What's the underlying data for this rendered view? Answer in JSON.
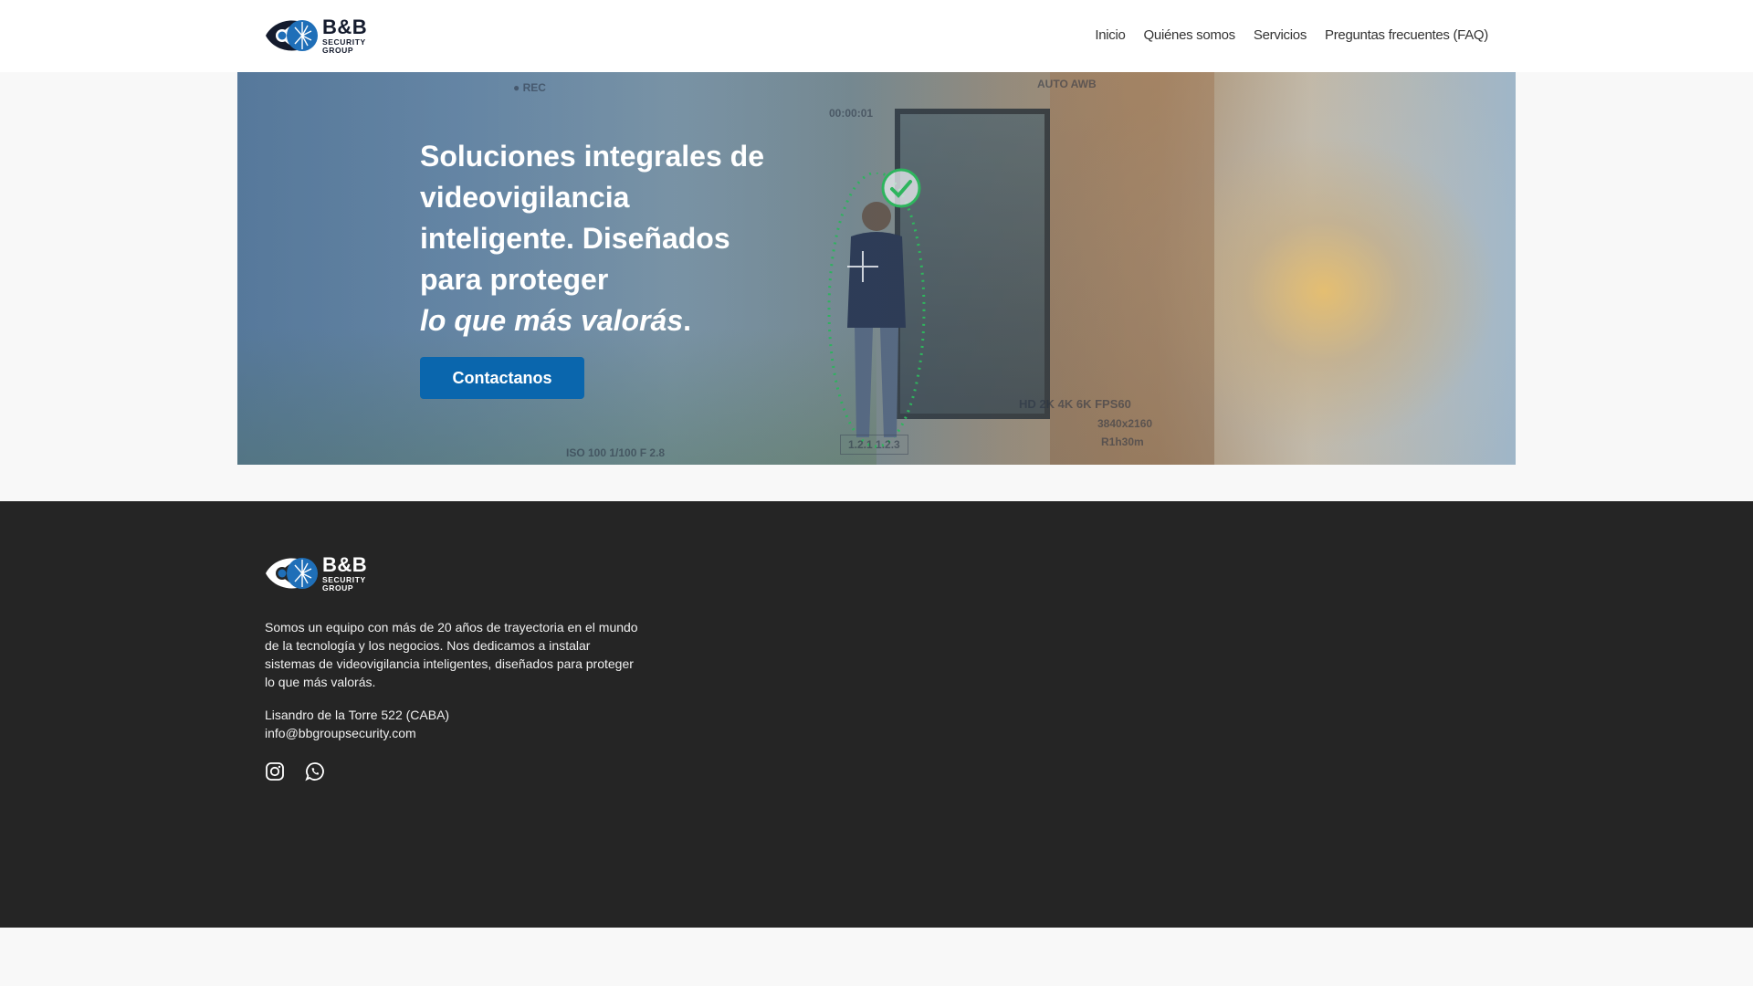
{
  "brand": {
    "name": "B&B",
    "line1": "SECURITY",
    "line2": "GROUP"
  },
  "nav": {
    "items": [
      "Inicio",
      "Quiénes somos",
      "Servicios",
      "Preguntas frecuentes (FAQ)"
    ]
  },
  "hero": {
    "title_lines": [
      "Soluciones integrales de",
      "videovigilancia",
      "inteligente. Diseñados",
      "para proteger"
    ],
    "title_emphasis": "lo que más valorás",
    "title_end": ".",
    "cta_label": "Contactanos",
    "hud": {
      "rec": "● REC",
      "time": "00:00:01",
      "auto": "AUTO\nAWB",
      "hd": "HD 2K 4K 6K   FPS60",
      "res": "3840x2160",
      "rh": "R1h30m",
      "iso": "ISO 100  1/100  F 2.8",
      "seg": "1.2.1   1.2.3"
    }
  },
  "footer": {
    "about": "Somos un equipo con más de 20 años de trayectoria en el mundo de la tecnología y los negocios. Nos dedicamos a instalar sistemas de videovigilancia inteligentes, diseñados para proteger lo que más valorás.",
    "address": "Lisandro de la Torre 522 (CABA)",
    "email": "info@bbgroupsecurity.com",
    "social": [
      "instagram-icon",
      "whatsapp-icon"
    ]
  },
  "colors": {
    "accent": "#0a66ad",
    "footer_bg": "#252525",
    "logo_blue": "#1f6fb8",
    "logo_dark": "#141b2d"
  }
}
